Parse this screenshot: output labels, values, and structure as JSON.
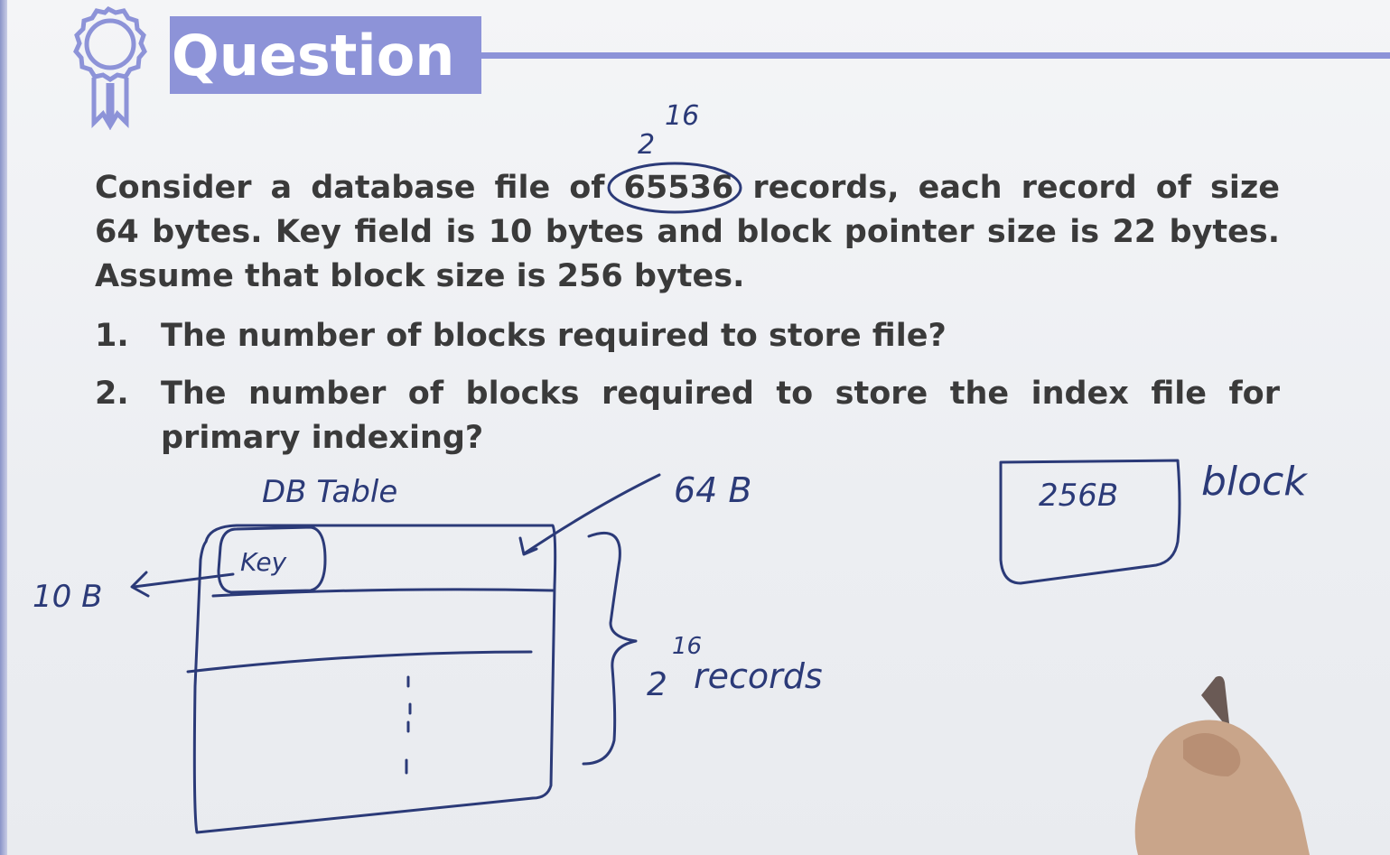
{
  "header": {
    "title": "Question"
  },
  "problem": {
    "lines": [
      "Consider a database file of 65536 records, each record of size",
      "64 bytes. Key field is 10 bytes and block pointer size is 22 bytes.",
      "Assume that block size is 256 bytes."
    ],
    "line1_before": "Consider a database file of",
    "line1_number": "65536",
    "line1_after": "records, each record of size"
  },
  "questions": [
    {
      "number": "1.",
      "lines": [
        "The number of blocks required to store file?"
      ]
    },
    {
      "number": "2.",
      "lines": [
        "The number of blocks required to store the index file for",
        "primary indexing?"
      ]
    }
  ],
  "annotations": {
    "exp_base": "2",
    "exp_power": "16",
    "db_table_label": "DB Table",
    "record_size": "64 B",
    "key_label": "Key",
    "key_size": "10 B",
    "records_count_base": "2",
    "records_count_power": "16",
    "records_word": "records",
    "block_size": "256B",
    "block_word": "block"
  },
  "colors": {
    "accent": "#8d93d8",
    "text": "#3a3a3a",
    "ink": "#2b3a78"
  }
}
